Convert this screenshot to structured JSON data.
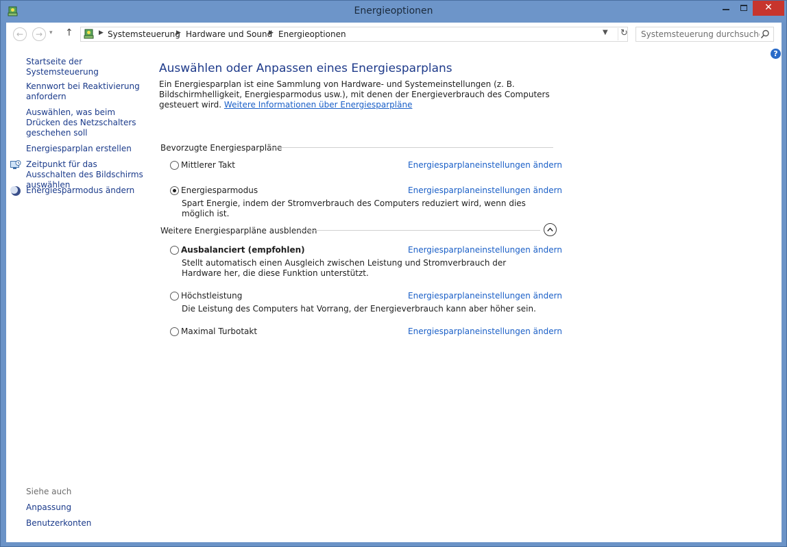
{
  "window": {
    "title": "Energieoptionen",
    "close_glyph": "✕"
  },
  "address": {
    "crumbs": [
      "Systemsteuerung",
      "Hardware und Sound",
      "Energieoptionen"
    ]
  },
  "search": {
    "placeholder": "Systemsteuerung durchsuchen"
  },
  "sidebar": {
    "home": "Startseite der Systemsteuerung",
    "items": [
      {
        "label": "Kennwort bei Reaktivierung anfordern",
        "icon": null
      },
      {
        "label": "Auswählen, was beim Drücken des Netzschalters geschehen soll",
        "icon": null
      },
      {
        "label": "Energiesparplan erstellen",
        "icon": null
      },
      {
        "label": "Zeitpunkt für das Ausschalten des Bildschirms auswählen",
        "icon": "monitor-clock-icon"
      },
      {
        "label": "Energiesparmodus ändern",
        "icon": "moon-icon"
      }
    ],
    "see_also_heading": "Siehe auch",
    "see_also": [
      "Anpassung",
      "Benutzerkonten"
    ]
  },
  "main": {
    "title": "Auswählen oder Anpassen eines Energiesparplans",
    "intro": "Ein Energiesparplan ist eine Sammlung von Hardware- und Systemeinstellungen (z. B. Bildschirmhelligkeit, Energiesparmodus usw.), mit denen der Energieverbrauch des Computers gesteuert wird.",
    "intro_link": "Weitere Informationen über Energiesparpläne",
    "preferred_heading": "Bevorzugte Energiesparpläne",
    "more_heading": "Weitere Energiesparpläne ausblenden",
    "change_link": "Energiesparplaneinstellungen ändern",
    "preferred_plans": [
      {
        "name": "Mittlerer Takt",
        "selected": false,
        "desc": ""
      },
      {
        "name": "Energiesparmodus",
        "selected": true,
        "desc": "Spart Energie, indem der Stromverbrauch des Computers reduziert wird, wenn dies möglich ist."
      }
    ],
    "more_plans": [
      {
        "name": "Ausbalanciert (empfohlen)",
        "selected": false,
        "desc": "Stellt automatisch einen Ausgleich zwischen Leistung und Stromverbrauch der Hardware her, die diese Funktion unterstützt."
      },
      {
        "name": "Höchstleistung",
        "selected": false,
        "desc": "Die Leistung des Computers hat Vorrang, der Energieverbrauch kann aber höher sein."
      },
      {
        "name": "Maximal Turbotakt",
        "selected": false,
        "desc": ""
      }
    ]
  },
  "colors": {
    "accent": "#1a5fc7",
    "frame": "#6d95c9",
    "close": "#c7352d"
  }
}
